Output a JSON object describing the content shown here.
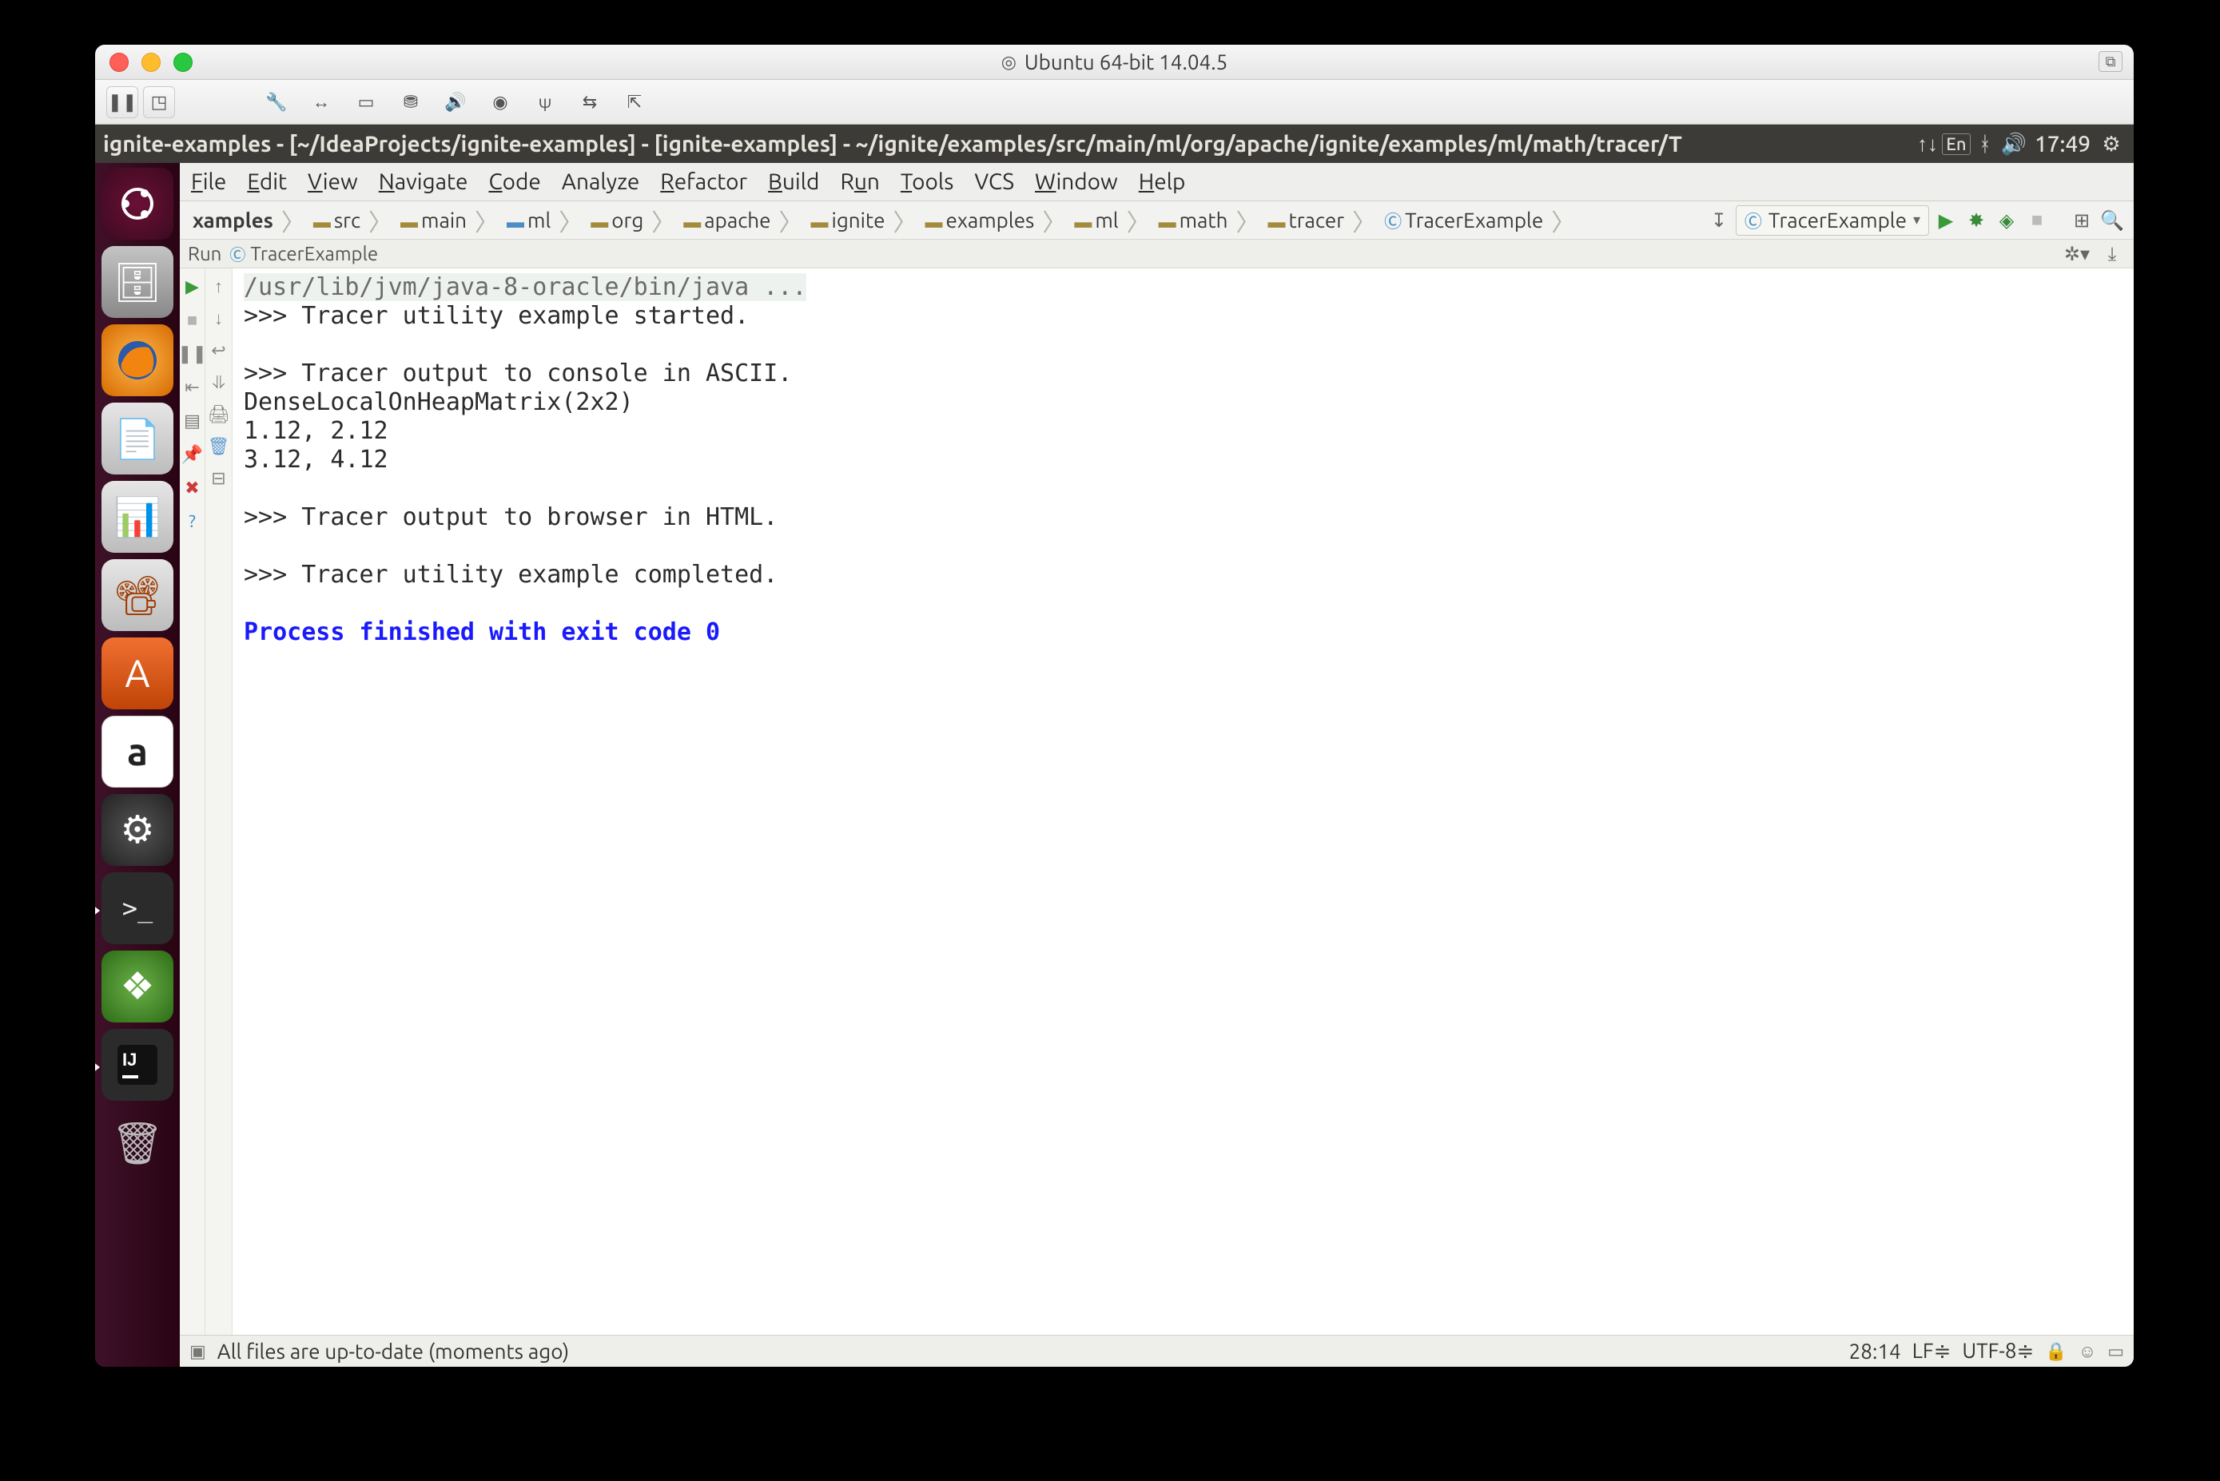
{
  "mac": {
    "title": "Ubuntu 64-bit 14.04.5"
  },
  "panel": {
    "title": "ignite-examples - [~/IdeaProjects/ignite-examples] - [ignite-examples] - ~/ignite/examples/src/main/ml/org/apache/ignite/examples/ml/math/tracer/T",
    "lang": "En",
    "time": "17:49"
  },
  "menu": {
    "file": "File",
    "edit": "Edit",
    "view": "View",
    "nav": "Navigate",
    "code": "Code",
    "analyze": "Analyze",
    "refactor": "Refactor",
    "build": "Build",
    "run": "Run",
    "tools": "Tools",
    "vcs": "VCS",
    "window": "Window",
    "help": "Help"
  },
  "crumbs": {
    "root": "xamples",
    "c1": "src",
    "c2": "main",
    "c3": "ml",
    "c4": "org",
    "c5": "apache",
    "c6": "ignite",
    "c7": "examples",
    "c8": "ml",
    "c9": "math",
    "c10": "tracer",
    "cls": "TracerExample"
  },
  "runselect": "TracerExample",
  "runtab": {
    "label": "Run",
    "name": "TracerExample"
  },
  "console": {
    "cmd": "/usr/lib/jvm/java-8-oracle/bin/java ...",
    "l1": ">>> Tracer utility example started.",
    "l2": "",
    "l3": ">>> Tracer output to console in ASCII.",
    "l4": "DenseLocalOnHeapMatrix(2x2)",
    "l5": "1.12, 2.12",
    "l6": "3.12, 4.12",
    "l7": "",
    "l8": ">>> Tracer output to browser in HTML.",
    "l9": "",
    "l10": ">>> Tracer utility example completed.",
    "l11": "",
    "exit": "Process finished with exit code 0"
  },
  "status": {
    "msg": "All files are up-to-date (moments ago)",
    "pos": "28:14",
    "le": "LF",
    "enc": "UTF-8"
  }
}
